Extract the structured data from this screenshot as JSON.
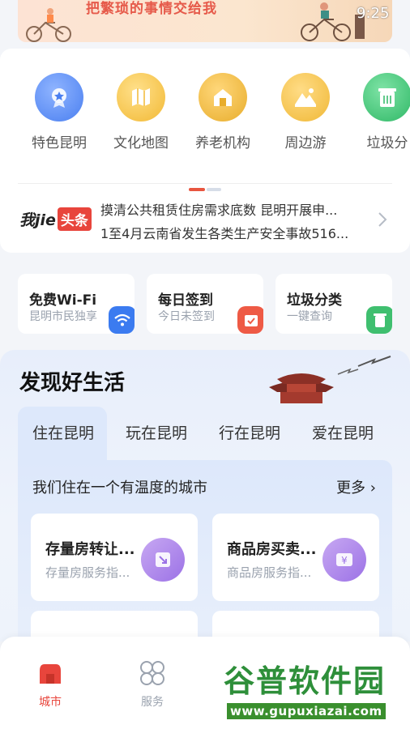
{
  "status_bar": {
    "time": "9:25"
  },
  "banner": {
    "slogan": "把繁琐的事情交给我"
  },
  "services": [
    {
      "label": "特色昆明",
      "icon": "medal-icon",
      "color": "#5b8ff5"
    },
    {
      "label": "文化地图",
      "icon": "map-icon",
      "color": "#f4c042"
    },
    {
      "label": "养老机构",
      "icon": "house-icon",
      "color": "#eebb3d"
    },
    {
      "label": "周边游",
      "icon": "mountain-icon",
      "color": "#f2c24b"
    },
    {
      "label": "垃圾分",
      "icon": "trash-bin-icon",
      "color": "#3fc378"
    }
  ],
  "news": {
    "logo_text": "我jie",
    "logo_badge": "头条",
    "items": [
      "摸清公共租赁住房需求底数 昆明开展申...",
      "1至4月云南省发生各类生产安全事故516..."
    ]
  },
  "quick_tiles": [
    {
      "title": "免费Wi-Fi",
      "subtitle": "昆明市民独享",
      "icon": "wifi-icon",
      "color": "#3b7bf0"
    },
    {
      "title": "每日签到",
      "subtitle": "今日未签到",
      "icon": "calendar-check-icon",
      "color": "#ee5a45"
    },
    {
      "title": "垃圾分类",
      "subtitle": "一键查询",
      "icon": "recycle-bin-icon",
      "color": "#3fbf6f"
    }
  ],
  "discover": {
    "title": "发现好生活",
    "tabs": [
      "住在昆明",
      "玩在昆明",
      "行在昆明",
      "爱在昆明"
    ],
    "active_tab": "住在昆明",
    "panel_title": "我们住在一个有温度的城市",
    "more_label": "更多",
    "cards": [
      {
        "title": "存量房转让...",
        "subtitle": "存量房服务指...",
        "icon": "transfer-icon"
      },
      {
        "title": "商品房买卖...",
        "subtitle": "商品房服务指...",
        "icon": "yuan-icon"
      }
    ]
  },
  "bottom_nav": [
    {
      "label": "城市",
      "icon": "city-icon",
      "active": true
    },
    {
      "label": "服务",
      "icon": "grid-icon",
      "active": false
    }
  ],
  "watermark": {
    "text": "谷普软件园",
    "url": "www.gupuxiazai.com"
  },
  "colors": {
    "accent": "#e8553f",
    "nav_active": "#e8453c",
    "nav_inactive": "#9aa2ae"
  }
}
